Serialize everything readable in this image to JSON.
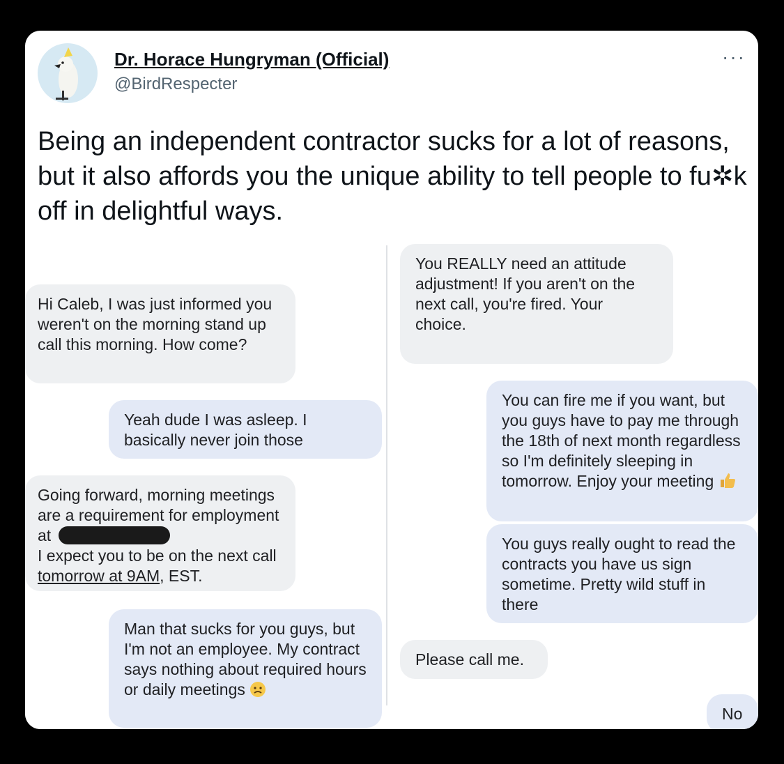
{
  "tweet": {
    "author_name": "Dr. Horace Hungryman (Official)",
    "handle": "@BirdRespecter",
    "more_label": "···",
    "text": "Being an independent contractor sucks for a lot of reasons, but it also affords you the unique ability to tell people to fu✲k off in delightful ways."
  },
  "chat": {
    "left": [
      {
        "text": "Hi Caleb, I was just informed you weren't on the morning stand up call this morning. How come?"
      },
      {
        "text": "Yeah dude I was asleep. I basically never join those"
      },
      {
        "line1": "Going forward, morning meetings are a requirement for employment at",
        "line2": "I expect you to be on the next call",
        "link": "tomorrow at 9AM",
        "tail": ", EST."
      },
      {
        "text": "Man that sucks for you guys, but I'm not an employee. My contract says nothing about required hours or daily meetings"
      }
    ],
    "right": [
      {
        "text": "You REALLY need an attitude adjustment! If you aren't on the next call, you're fired. Your choice."
      },
      {
        "text": "You can fire me if you want, but you guys have to pay me through the 18th of next month regardless so I'm definitely sleeping in tomorrow. Enjoy your meeting"
      },
      {
        "text": "You guys really ought to read the contracts you have us sign sometime. Pretty wild stuff in there"
      },
      {
        "text": "Please call me."
      },
      {
        "text": "No"
      }
    ]
  },
  "icons": {
    "avatar": "cockatoo-avatar-icon",
    "sad": "sad-face-icon",
    "thumbs": "thumbs-up-icon"
  },
  "colors": {
    "received_bubble": "#eef0f2",
    "sent_bubble": "#e3e9f6",
    "background": "#000000"
  }
}
